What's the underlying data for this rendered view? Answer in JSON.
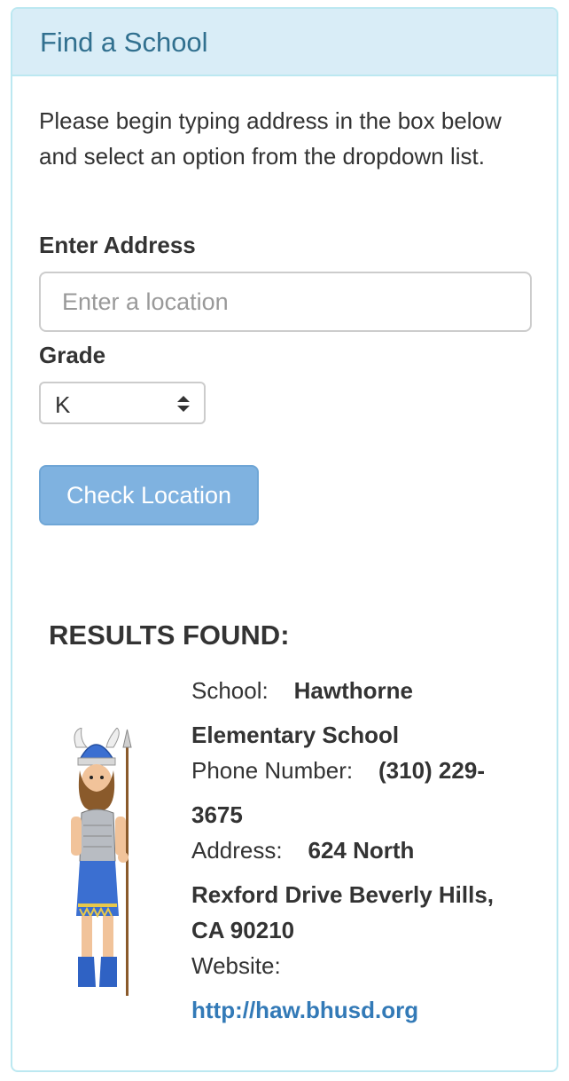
{
  "panel": {
    "title": "Find a School"
  },
  "form": {
    "intro": "Please begin typing address in the box below and select an option from the dropdown list.",
    "address_label": "Enter Address",
    "address_placeholder": "Enter a location",
    "address_value": "",
    "grade_label": "Grade",
    "grade_selected": "K",
    "submit_label": "Check Location"
  },
  "results": {
    "heading": "RESULTS FOUND:",
    "school_label": "School:",
    "school_name_line1": "Hawthorne",
    "school_name_line2": "Elementary School",
    "phone_label": "Phone Number:",
    "phone_line1": "(310) 229-",
    "phone_line2": "3675",
    "address_label": "Address:",
    "address_line1": "624 North",
    "address_line2": "Rexford Drive Beverly Hills,",
    "address_line3": "CA 90210",
    "website_label": "Website:",
    "website_url": "http://haw.bhusd.org",
    "mascot_icon": "viking-mascot-icon"
  },
  "colors": {
    "heading_bg": "#d9edf7",
    "heading_text": "#31708f",
    "border": "#bce8f1",
    "button_bg": "#7fb2e0",
    "link": "#337ab7"
  }
}
